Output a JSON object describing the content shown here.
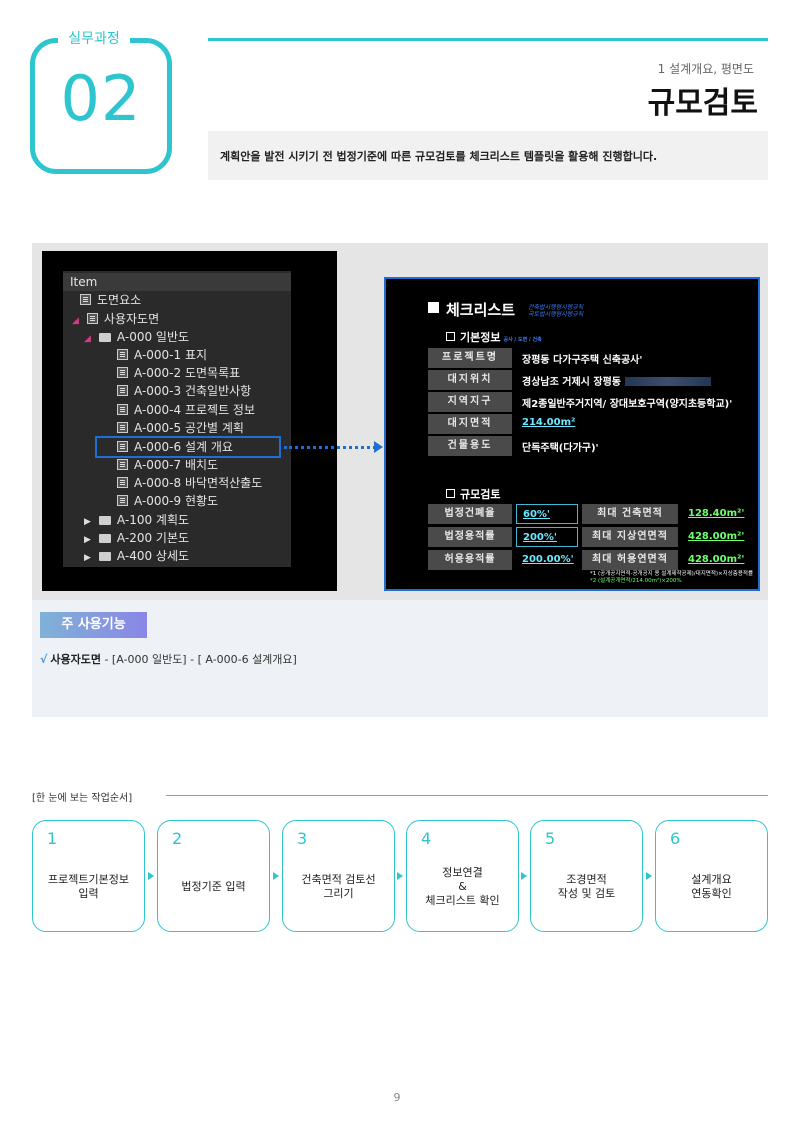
{
  "badge": {
    "label": "실무과정",
    "number": "02"
  },
  "header": {
    "subtitle": "1 설계개요, 평면도",
    "title": "규모검토",
    "intro": "계획안을 발전 시키기 전 법정기준에 따른 규모검토를 체크리스트 템플릿을 활용해 진행합니다."
  },
  "tree": {
    "header": "Item",
    "items": [
      {
        "label": "도면요소",
        "level": 0
      },
      {
        "label": "사용자도면",
        "level": 0
      },
      {
        "label": "A-000 일반도",
        "level": 1
      },
      {
        "label": "A-000-1 표지",
        "level": 2
      },
      {
        "label": "A-000-2 도면목록표",
        "level": 2
      },
      {
        "label": "A-000-3 건축일반사항",
        "level": 2
      },
      {
        "label": "A-000-4 프로젝트 정보",
        "level": 2
      },
      {
        "label": "A-000-5 공간별 계획",
        "level": 2
      },
      {
        "label": "A-000-6 설계 개요",
        "level": 2
      },
      {
        "label": "A-000-7 배치도",
        "level": 2
      },
      {
        "label": "A-000-8 바닥면적산출도",
        "level": 2
      },
      {
        "label": "A-000-9 현황도",
        "level": 2
      },
      {
        "label": "A-100 계획도",
        "level": 1
      },
      {
        "label": "A-200 기본도",
        "level": 1
      },
      {
        "label": "A-400 상세도",
        "level": 1
      }
    ]
  },
  "checklist": {
    "title": "체크리스트",
    "title_note_1": "건축법시행령시행규칙",
    "title_note_2": "국토법시행령시행규칙",
    "basic_section": "기본정보",
    "basic_section_note": "공사 / 도면 / 건축",
    "basic_rows": [
      {
        "label": "프로젝트명",
        "value": "장평동 다가구주택 신축공사'"
      },
      {
        "label": "대지위치",
        "value": "경상남조 거제시 장평동"
      },
      {
        "label": "지역지구",
        "value": "제2종일반주거지역/ 장대보호구역(양지초등학교)'"
      },
      {
        "label": "대지면적",
        "value": "214.00m²"
      },
      {
        "label": "건물용도",
        "value": "단독주택(다가구)'"
      }
    ],
    "scale_section": "규모검토",
    "scale_rows": [
      {
        "label": "법정건폐율",
        "value": "60%'",
        "label2": "최대 건축면적",
        "value2": "128.40m²'"
      },
      {
        "label": "법정용적률",
        "value": "200%'",
        "label2": "최대 지상연면적",
        "value2": "428.00m²'"
      },
      {
        "label": "허용용적률",
        "value": "200.00%'",
        "label2": "최대 허용연면적",
        "value2": "428.00m²'"
      }
    ],
    "note_1": "*1 (공개공지면적-공개공지 용 설계제작공제)/대지면적)×지상층용적률",
    "note_2": "*2 (설계공개면적/214.00m²)×200%"
  },
  "features": {
    "tag": "주 사용기능",
    "check": "√",
    "item_name": "사용자도면",
    "item_path": " -  [A-000 일반도] - [ A-000-6 설계개요]"
  },
  "workflow": {
    "label": "[한 눈에 보는 작업순서]",
    "steps": [
      {
        "num": "1",
        "text": "프로젝트기본정보\n입력"
      },
      {
        "num": "2",
        "text": "법정기준 입력"
      },
      {
        "num": "3",
        "text": "건축면적 검토선\n그리기"
      },
      {
        "num": "4",
        "text": "정보연결\n&\n체크리스트 확인"
      },
      {
        "num": "5",
        "text": "조경면적\n작성 및 검토"
      },
      {
        "num": "6",
        "text": "설계개요\n연동확인"
      }
    ]
  },
  "page_number": "9",
  "colors": {
    "accent": "#2ec5cf",
    "highlight": "#1f6fd1"
  }
}
